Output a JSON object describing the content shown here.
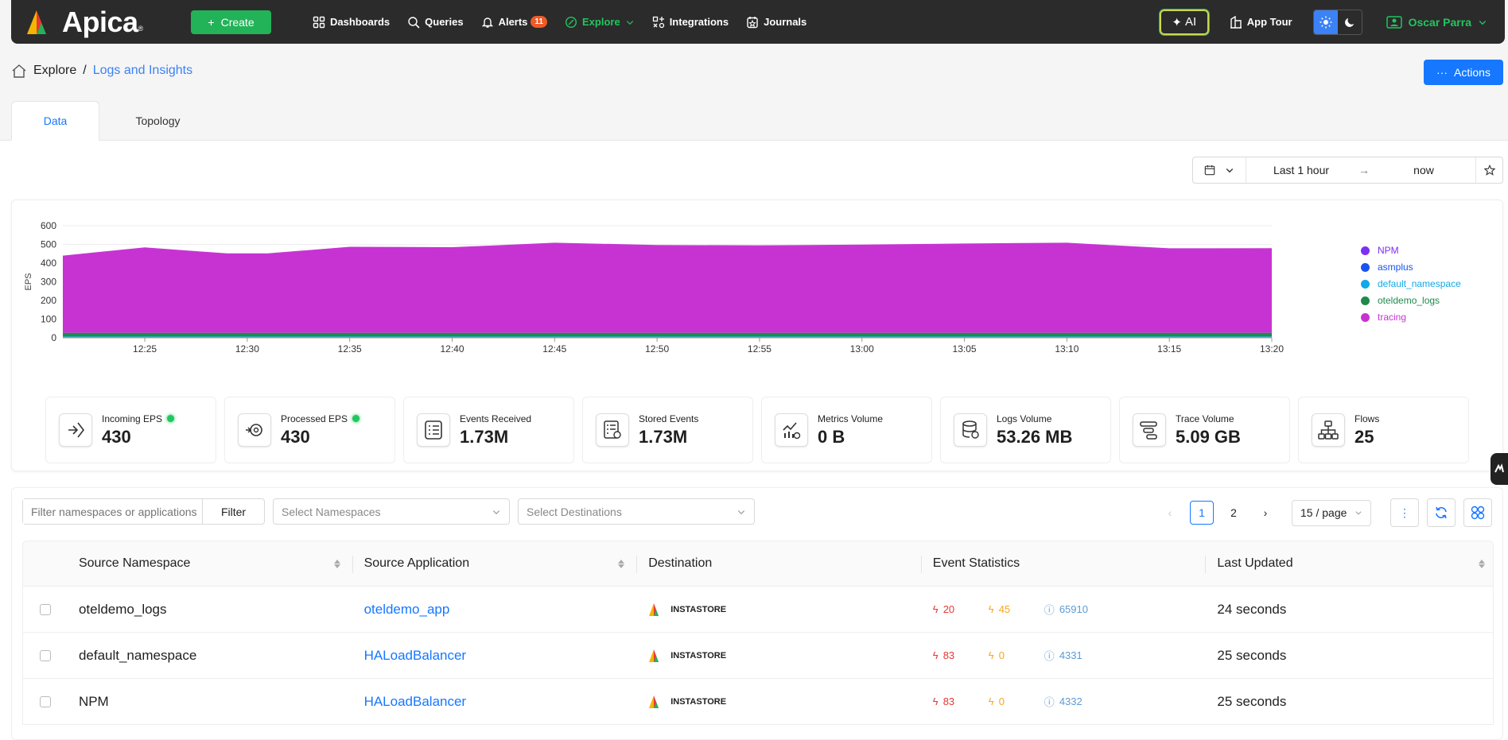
{
  "brand": {
    "name": "Apica"
  },
  "topbar": {
    "create_label": "Create",
    "nav": [
      {
        "label": "Dashboards",
        "icon": "dashboard-icon"
      },
      {
        "label": "Queries",
        "icon": "query-icon"
      },
      {
        "label": "Alerts",
        "icon": "bell-icon",
        "badge": "11"
      },
      {
        "label": "Explore",
        "icon": "compass-icon",
        "active": true
      },
      {
        "label": "Integrations",
        "icon": "integrations-icon"
      },
      {
        "label": "Journals",
        "icon": "journal-icon"
      }
    ],
    "ai_label": "AI",
    "app_tour_label": "App Tour",
    "user_name": "Oscar Parra"
  },
  "breadcrumb": {
    "root": "Explore",
    "separator": "/",
    "current": "Logs and Insights"
  },
  "actions_label": "Actions",
  "tabs": [
    {
      "label": "Data",
      "active": true
    },
    {
      "label": "Topology"
    }
  ],
  "timepicker": {
    "from": "Last 1 hour",
    "to": "now"
  },
  "chart_data": {
    "type": "area",
    "ylabel": "EPS",
    "ylim": [
      0,
      600
    ],
    "yticks": [
      0,
      100,
      200,
      300,
      400,
      500,
      600
    ],
    "xticks": [
      "12:25",
      "12:30",
      "12:35",
      "12:40",
      "12:45",
      "12:50",
      "12:55",
      "13:00",
      "13:05",
      "13:10",
      "13:15",
      "13:20"
    ],
    "x": [
      "12:21",
      "12:25",
      "12:29",
      "12:31",
      "12:35",
      "12:40",
      "12:45",
      "12:50",
      "12:55",
      "13:00",
      "13:05",
      "13:10",
      "13:15",
      "13:20"
    ],
    "series": [
      {
        "name": "NPM",
        "color": "#7b2ff7",
        "values": [
          2,
          2,
          2,
          2,
          2,
          2,
          2,
          2,
          2,
          2,
          2,
          2,
          2,
          2
        ]
      },
      {
        "name": "asmplus",
        "color": "#1a53f0",
        "values": [
          1,
          1,
          1,
          1,
          1,
          1,
          1,
          1,
          1,
          1,
          1,
          1,
          1,
          1
        ]
      },
      {
        "name": "default_namespace",
        "color": "#13a8e8",
        "values": [
          4,
          4,
          4,
          4,
          4,
          4,
          4,
          4,
          4,
          4,
          4,
          4,
          4,
          4
        ]
      },
      {
        "name": "oteldemo_logs",
        "color": "#1e8a4c",
        "values": [
          20,
          20,
          20,
          20,
          20,
          20,
          20,
          20,
          20,
          20,
          20,
          20,
          20,
          20
        ]
      },
      {
        "name": "tracing",
        "color": "#c733d3",
        "values": [
          413,
          457,
          425,
          425,
          460,
          458,
          482,
          470,
          468,
          472,
          478,
          482,
          452,
          453
        ]
      }
    ]
  },
  "stats": [
    {
      "label": "Incoming EPS",
      "value": "430",
      "live": true,
      "icon": "incoming-icon"
    },
    {
      "label": "Processed EPS",
      "value": "430",
      "live": true,
      "icon": "processed-icon"
    },
    {
      "label": "Events Received",
      "value": "1.73M",
      "icon": "events-icon"
    },
    {
      "label": "Stored Events",
      "value": "1.73M",
      "icon": "stored-icon"
    },
    {
      "label": "Metrics Volume",
      "value": "0 B",
      "icon": "metrics-icon"
    },
    {
      "label": "Logs Volume",
      "value": "53.26 MB",
      "icon": "database-icon"
    },
    {
      "label": "Trace Volume",
      "value": "5.09 GB",
      "icon": "trace-icon"
    },
    {
      "label": "Flows",
      "value": "25",
      "icon": "flows-icon"
    }
  ],
  "filters": {
    "search_placeholder": "Filter namespaces or applications",
    "filter_label": "Filter",
    "namespaces_placeholder": "Select Namespaces",
    "destinations_placeholder": "Select Destinations"
  },
  "pager": {
    "pages": [
      "1",
      "2"
    ],
    "current": "1",
    "page_size": "15 / page"
  },
  "table": {
    "headers": [
      "Source Namespace",
      "Source Application",
      "Destination",
      "Event Statistics",
      "Last Updated"
    ],
    "rows": [
      {
        "namespace": "oteldemo_logs",
        "application": "oteldemo_app",
        "destination": "INSTASTORE",
        "errors": "20",
        "warnings": "45",
        "info": "65910",
        "updated": "24 seconds"
      },
      {
        "namespace": "default_namespace",
        "application": "HALoadBalancer",
        "destination": "INSTASTORE",
        "errors": "83",
        "warnings": "0",
        "info": "4331",
        "updated": "25 seconds"
      },
      {
        "namespace": "NPM",
        "application": "HALoadBalancer",
        "destination": "INSTASTORE",
        "errors": "83",
        "warnings": "0",
        "info": "4332",
        "updated": "25 seconds"
      }
    ]
  }
}
